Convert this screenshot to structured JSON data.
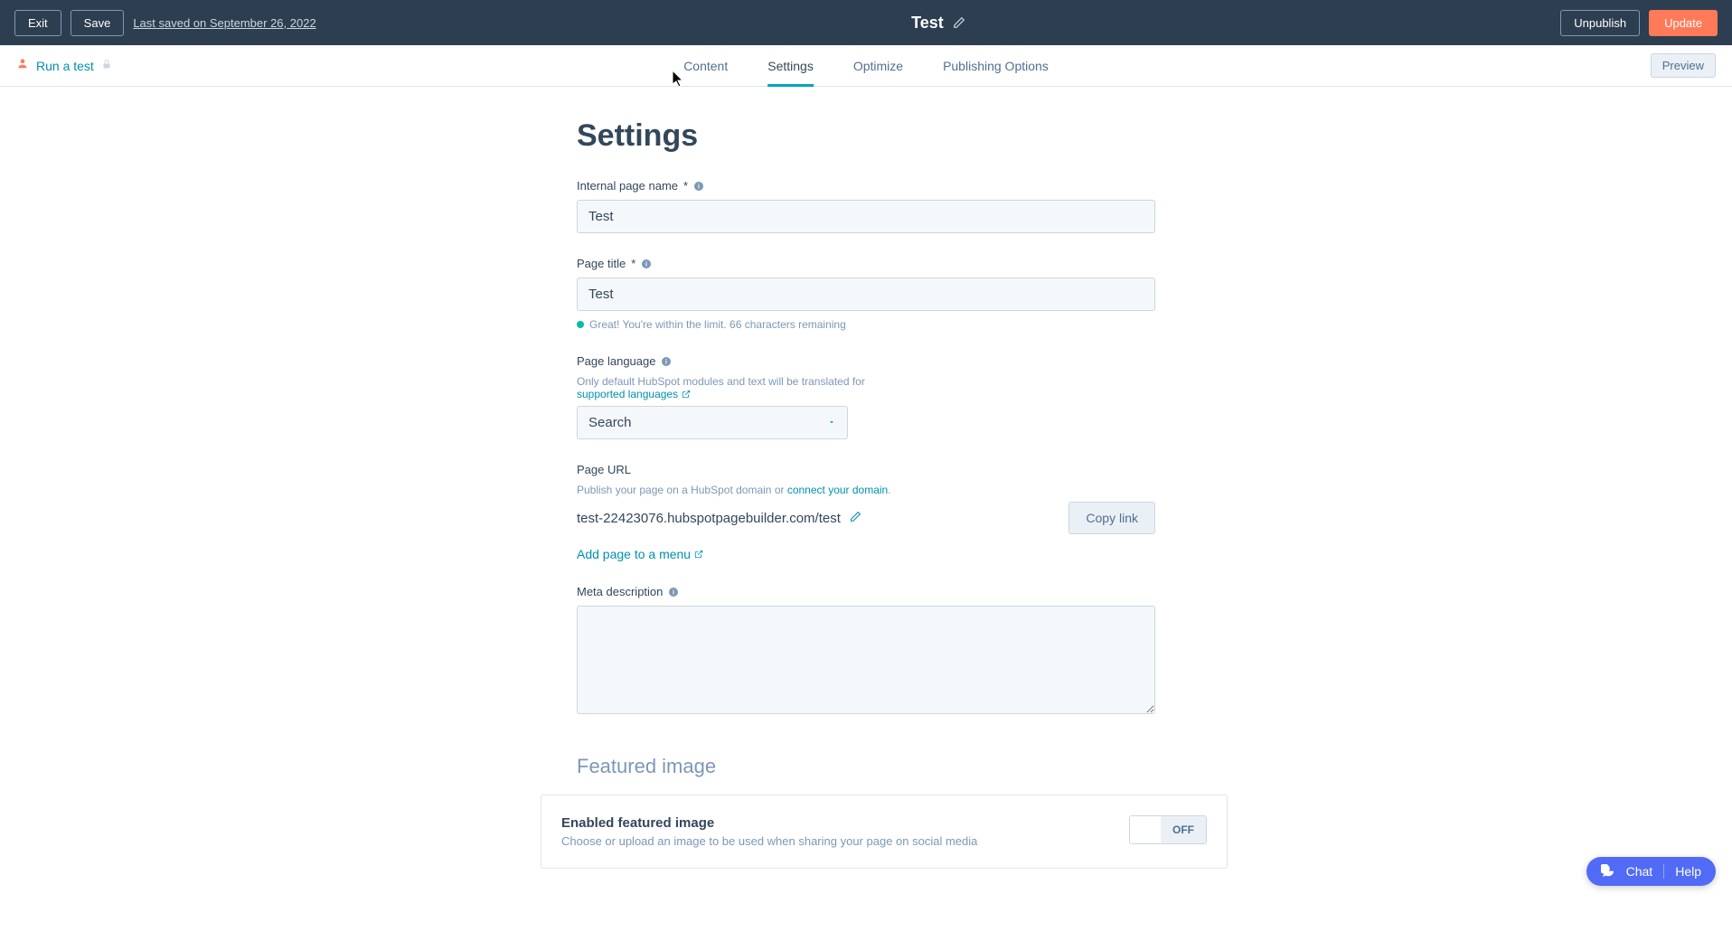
{
  "topbar": {
    "exit": "Exit",
    "save": "Save",
    "last_saved": "Last saved on September 26, 2022",
    "page_name": "Test",
    "unpublish": "Unpublish",
    "update": "Update"
  },
  "subnav": {
    "run_test": "Run a test",
    "tabs": [
      "Content",
      "Settings",
      "Optimize",
      "Publishing Options"
    ],
    "active_index": 1,
    "preview": "Preview"
  },
  "settings": {
    "heading": "Settings",
    "internal_name": {
      "label": "Internal page name",
      "required": "*",
      "value": "Test"
    },
    "page_title": {
      "label": "Page title",
      "required": "*",
      "value": "Test",
      "hint": "Great! You're within the limit. 66 characters remaining"
    },
    "page_language": {
      "label": "Page language",
      "help": "Only default HubSpot modules and text will be translated for",
      "supported": "supported languages",
      "placeholder": "Search"
    },
    "page_url": {
      "label": "Page URL",
      "help_pre": "Publish your page on a HubSpot domain or ",
      "connect": "connect your domain",
      "help_post": ".",
      "url": "test-22423076.hubspotpagebuilder.com/test",
      "copy": "Copy link",
      "add_menu": "Add page to a menu"
    },
    "meta": {
      "label": "Meta description",
      "value": ""
    },
    "featured": {
      "heading": "Featured image",
      "title": "Enabled featured image",
      "subtitle": "Choose or upload an image to be used when sharing your page on social media",
      "toggle": "OFF"
    }
  },
  "chat": {
    "chat": "Chat",
    "help": "Help"
  }
}
